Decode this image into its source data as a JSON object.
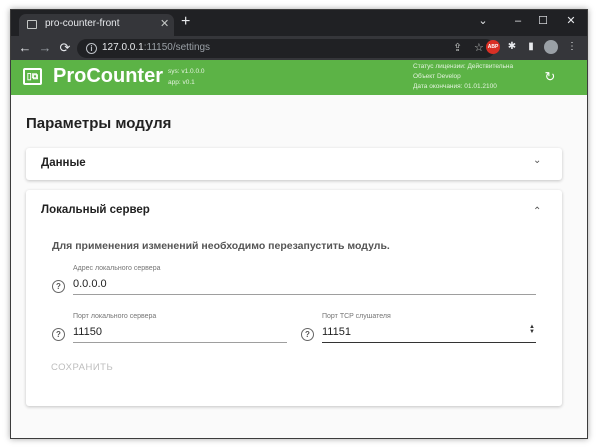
{
  "browser": {
    "tab_title": "pro-counter-front",
    "new_tab": "+",
    "tab_close": "✕",
    "url_host": "127.0.0.1",
    "url_path": ":11150/settings",
    "controls": {
      "dropdown": "⌄",
      "minimize": "–",
      "maximize": "☐",
      "close": "✕"
    },
    "nav": {
      "back": "←",
      "forward": "→",
      "reload": "⟳",
      "info": "i",
      "share": "⇪",
      "star": "☆"
    },
    "extensions": {
      "abp": "ABP",
      "puzzle": "✱",
      "sidepanel": "▮",
      "menu": "⋮"
    }
  },
  "app": {
    "logo_glyph": "▯⧉",
    "title": "ProCounter",
    "sys_version": "sys: v1.0.0.0",
    "app_version": "app: v0.1",
    "license_status": "Статус лицензии: Действительна",
    "object": "Объект Develop",
    "expiry": "Дата окончания: 01.01.2100",
    "refresh": "↻"
  },
  "page": {
    "title": "Параметры модуля",
    "sections": {
      "data": {
        "title": "Данные",
        "chevron": "⌄"
      },
      "local_server": {
        "title": "Локальный сервер",
        "chevron": "⌃",
        "notice": "Для применения изменений необходимо перезапустить модуль.",
        "help_icon": "?",
        "address": {
          "label": "Адрес локального сервера",
          "value": "0.0.0.0"
        },
        "port": {
          "label": "Порт локального сервера",
          "value": "11150"
        },
        "tcp_port": {
          "label": "Порт TCP слушателя",
          "value": "11151"
        },
        "spinner_up": "▲",
        "spinner_down": "▼",
        "save": "СОХРАНИТЬ"
      }
    }
  },
  "colors": {
    "header": "#5cb346",
    "chrome_dark": "#202124",
    "chrome_toolbar": "#35363a"
  }
}
